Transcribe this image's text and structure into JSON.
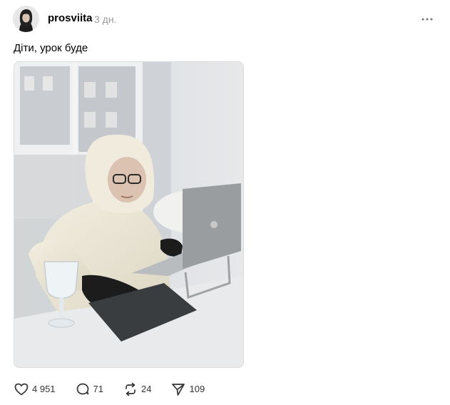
{
  "post": {
    "author": {
      "username": "prosviita",
      "avatar_icon": "profile-avatar"
    },
    "timestamp": "3 дн.",
    "caption": "Діти, урок буде",
    "image": {
      "alt_icon": "photo-woman-laptop"
    },
    "menu_icon": "more-horizontal-icon",
    "actions": {
      "like": {
        "icon": "heart-icon",
        "count": "4 951"
      },
      "reply": {
        "icon": "comment-icon",
        "count": "71"
      },
      "repost": {
        "icon": "repost-icon",
        "count": "24"
      },
      "share": {
        "icon": "send-icon",
        "count": "109"
      }
    }
  },
  "colors": {
    "text": "#000000",
    "muted": "#999999",
    "icon": "#333333"
  }
}
